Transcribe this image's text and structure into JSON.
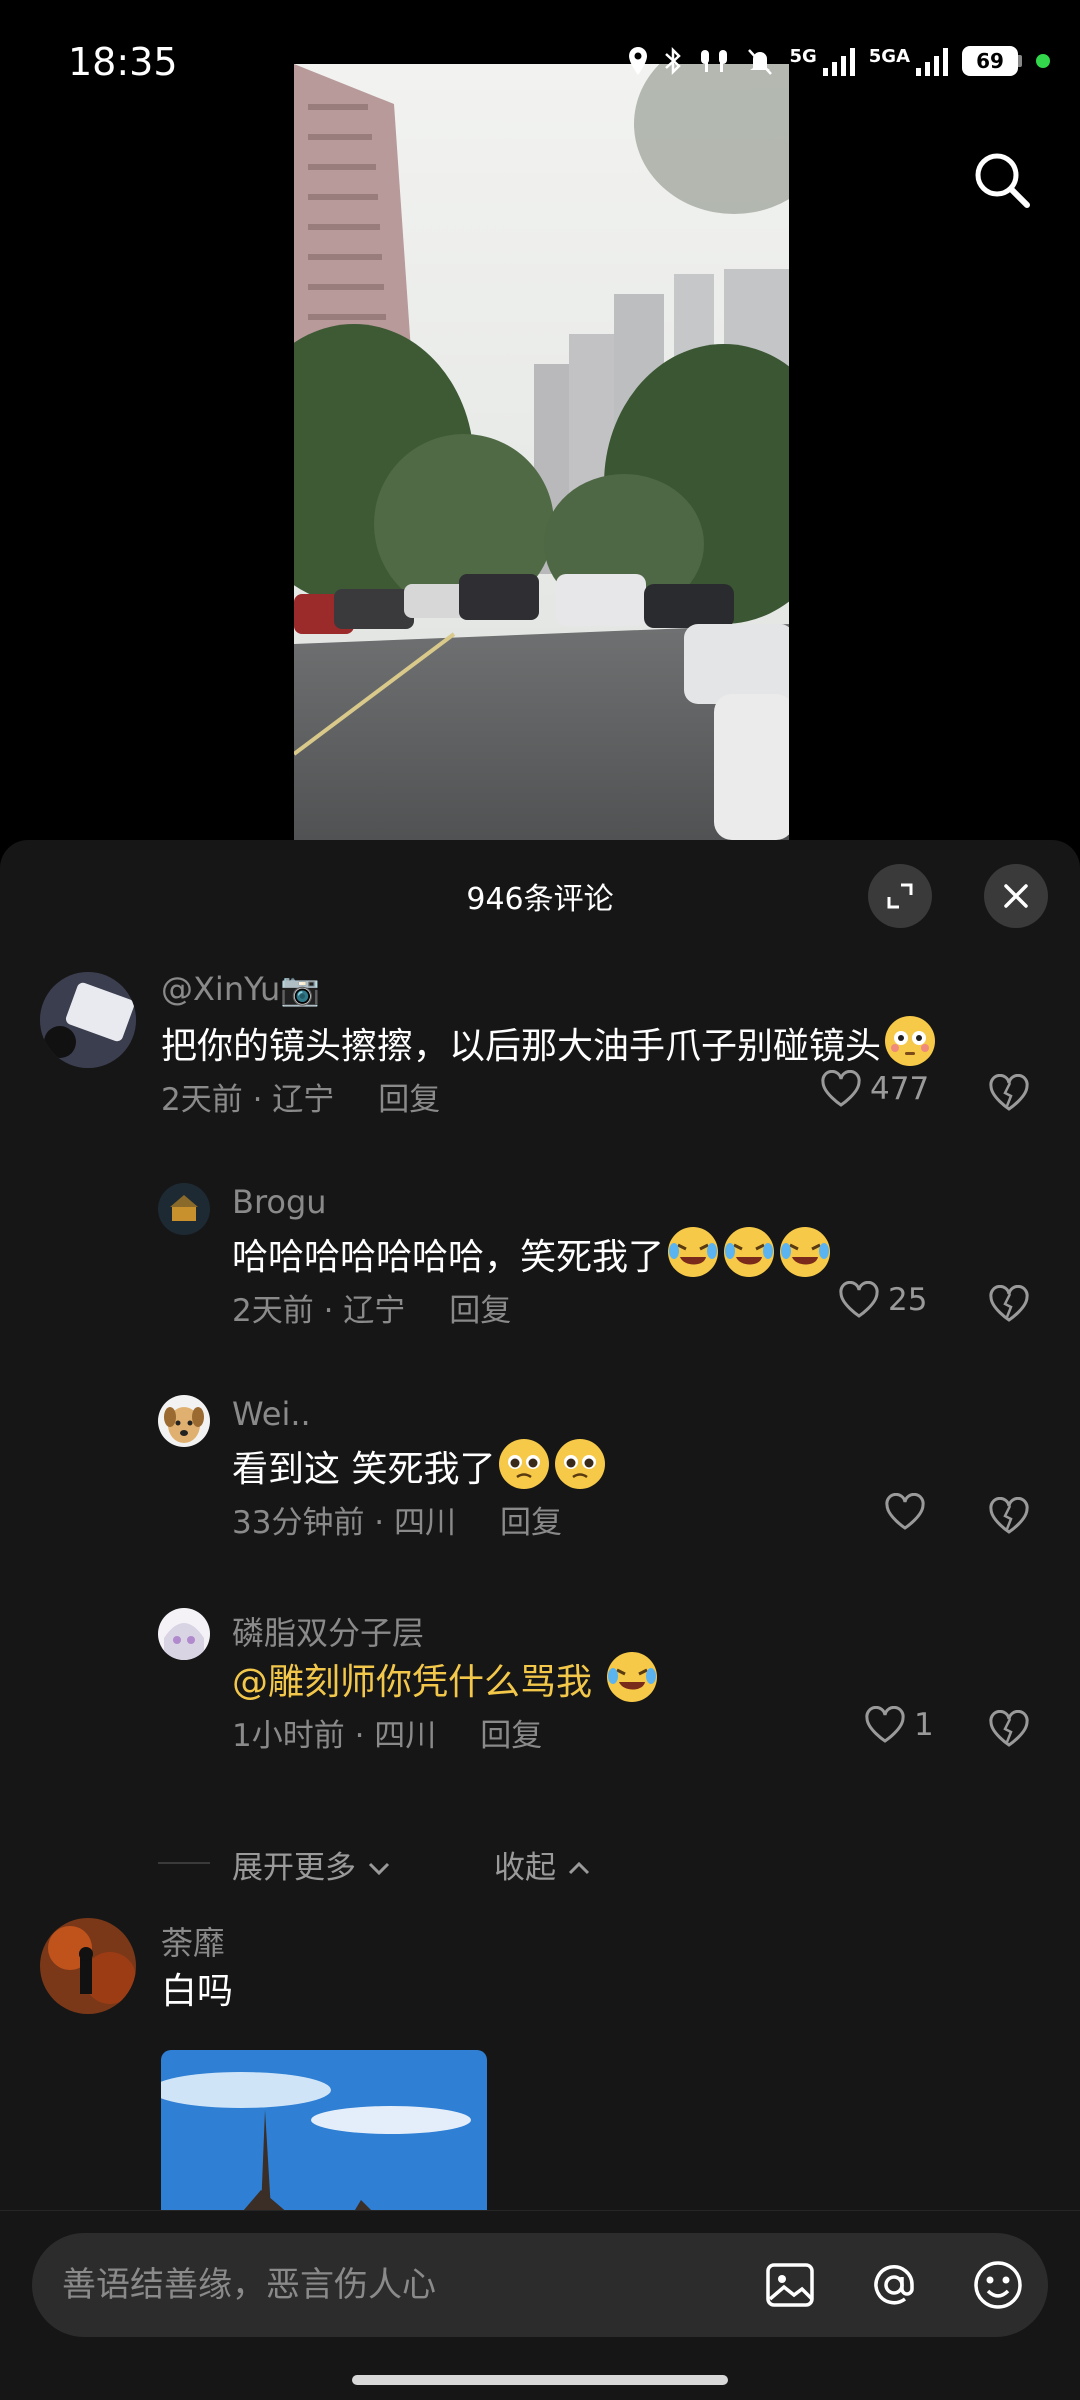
{
  "status_bar": {
    "time": "18:35",
    "network_1": "5G",
    "network_2": "5GA",
    "battery": "69"
  },
  "video": {
    "icon_search": "search-icon"
  },
  "comments_sheet": {
    "title": "946条评论",
    "comments": [
      {
        "username": "@XinYu📷",
        "text": "把你的镜头擦擦，以后那大油手爪子别碰镜头",
        "time": "2天前",
        "location": "辽宁",
        "reply_label": "回复",
        "likes": "477"
      },
      {
        "username": "Brogu",
        "text": "哈哈哈哈哈哈哈，笑死我了",
        "time": "2天前",
        "location": "辽宁",
        "reply_label": "回复",
        "likes": "25"
      },
      {
        "username": "Wei..",
        "text": "看到这 笑死我了",
        "time": "33分钟前",
        "location": "四川",
        "reply_label": "回复",
        "likes": ""
      },
      {
        "username": "磷脂双分子层",
        "mention": "@雕刻师你凭什么骂我",
        "time": "1小时前",
        "location": "四川",
        "reply_label": "回复",
        "likes": "1"
      },
      {
        "username": "荼靡",
        "text": "白吗"
      }
    ],
    "expand_more": "展开更多",
    "collapse": "收起"
  },
  "input_bar": {
    "placeholder": "善语结善缘，恶言伤人心"
  },
  "colors": {
    "sheet_bg": "#161616",
    "mention": "#f3c84a",
    "muted_text": "#8a8a8a"
  }
}
